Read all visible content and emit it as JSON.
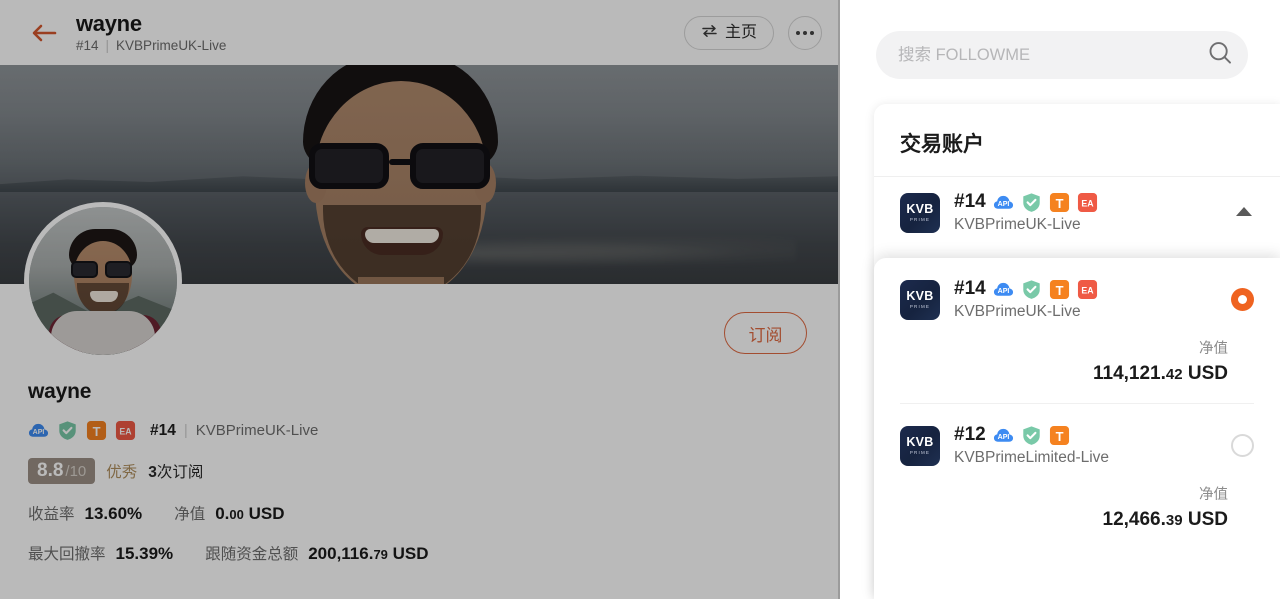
{
  "left": {
    "header": {
      "back_icon": "back-arrow-icon",
      "name": "wayne",
      "account_no": "#14",
      "separator": "|",
      "broker": "KVBPrimeUK-Live",
      "home_button": "主页",
      "home_icon": "swap-arrows-icon",
      "more_icon": "more-dots-icon"
    },
    "subscribe_button": "订阅",
    "profile": {
      "name": "wayne",
      "badges": [
        "api-badge",
        "verified-shield-badge",
        "t-badge",
        "ea-badge"
      ],
      "account_no": "#14",
      "separator": "|",
      "broker": "KVBPrimeUK-Live",
      "rating_score": "8.8",
      "rating_max": "/10",
      "rating_label": "优秀",
      "subscription_count": "3",
      "subscription_unit": "次订阅",
      "stats": {
        "return_label": "收益率",
        "return_value": "13.60%",
        "equity_label": "净值",
        "equity_int": "0.",
        "equity_dec": "00",
        "equity_currency": " USD",
        "drawdown_label": "最大回撤率",
        "drawdown_value": "15.39%",
        "follow_label": "跟随资金总额",
        "follow_int": "200,116.",
        "follow_dec": "79",
        "follow_currency": " USD"
      }
    }
  },
  "right": {
    "search": {
      "placeholder": "搜索 FOLLOWME",
      "value": "",
      "icon": "search-icon"
    },
    "accounts_card": {
      "title": "交易账户",
      "current": {
        "logo_main": "KVB",
        "logo_sub": "PRIME",
        "account_id": "#14",
        "broker": "KVBPrimeUK-Live",
        "badges": [
          "api-badge",
          "verified-shield-badge",
          "t-badge",
          "ea-badge"
        ],
        "collapse_icon": "caret-up-icon"
      },
      "items": [
        {
          "logo_main": "KVB",
          "logo_sub": "PRIME",
          "account_id": "#14",
          "broker": "KVBPrimeUK-Live",
          "badges": [
            "api-badge",
            "verified-shield-badge",
            "t-badge",
            "ea-badge"
          ],
          "selected": true,
          "equity_label": "净值",
          "equity_int": "114,121.",
          "equity_dec": "42",
          "equity_currency": " USD"
        },
        {
          "logo_main": "KVB",
          "logo_sub": "PRIME",
          "account_id": "#12",
          "broker": "KVBPrimeLimited-Live",
          "badges": [
            "api-badge",
            "verified-shield-badge",
            "t-badge"
          ],
          "selected": false,
          "equity_label": "净值",
          "equity_int": "12,466.",
          "equity_dec": "39",
          "equity_currency": " USD"
        }
      ]
    }
  },
  "colors": {
    "accent_orange": "#ef6320",
    "subscribe_border": "#e06a42",
    "rating_chip": "#9b8f85",
    "api_blue": "#3d8bf2",
    "shield_green": "#79c9a8",
    "t_orange": "#f58220",
    "ea_red": "#ef5a45",
    "kvb_navy": "#16233f"
  }
}
